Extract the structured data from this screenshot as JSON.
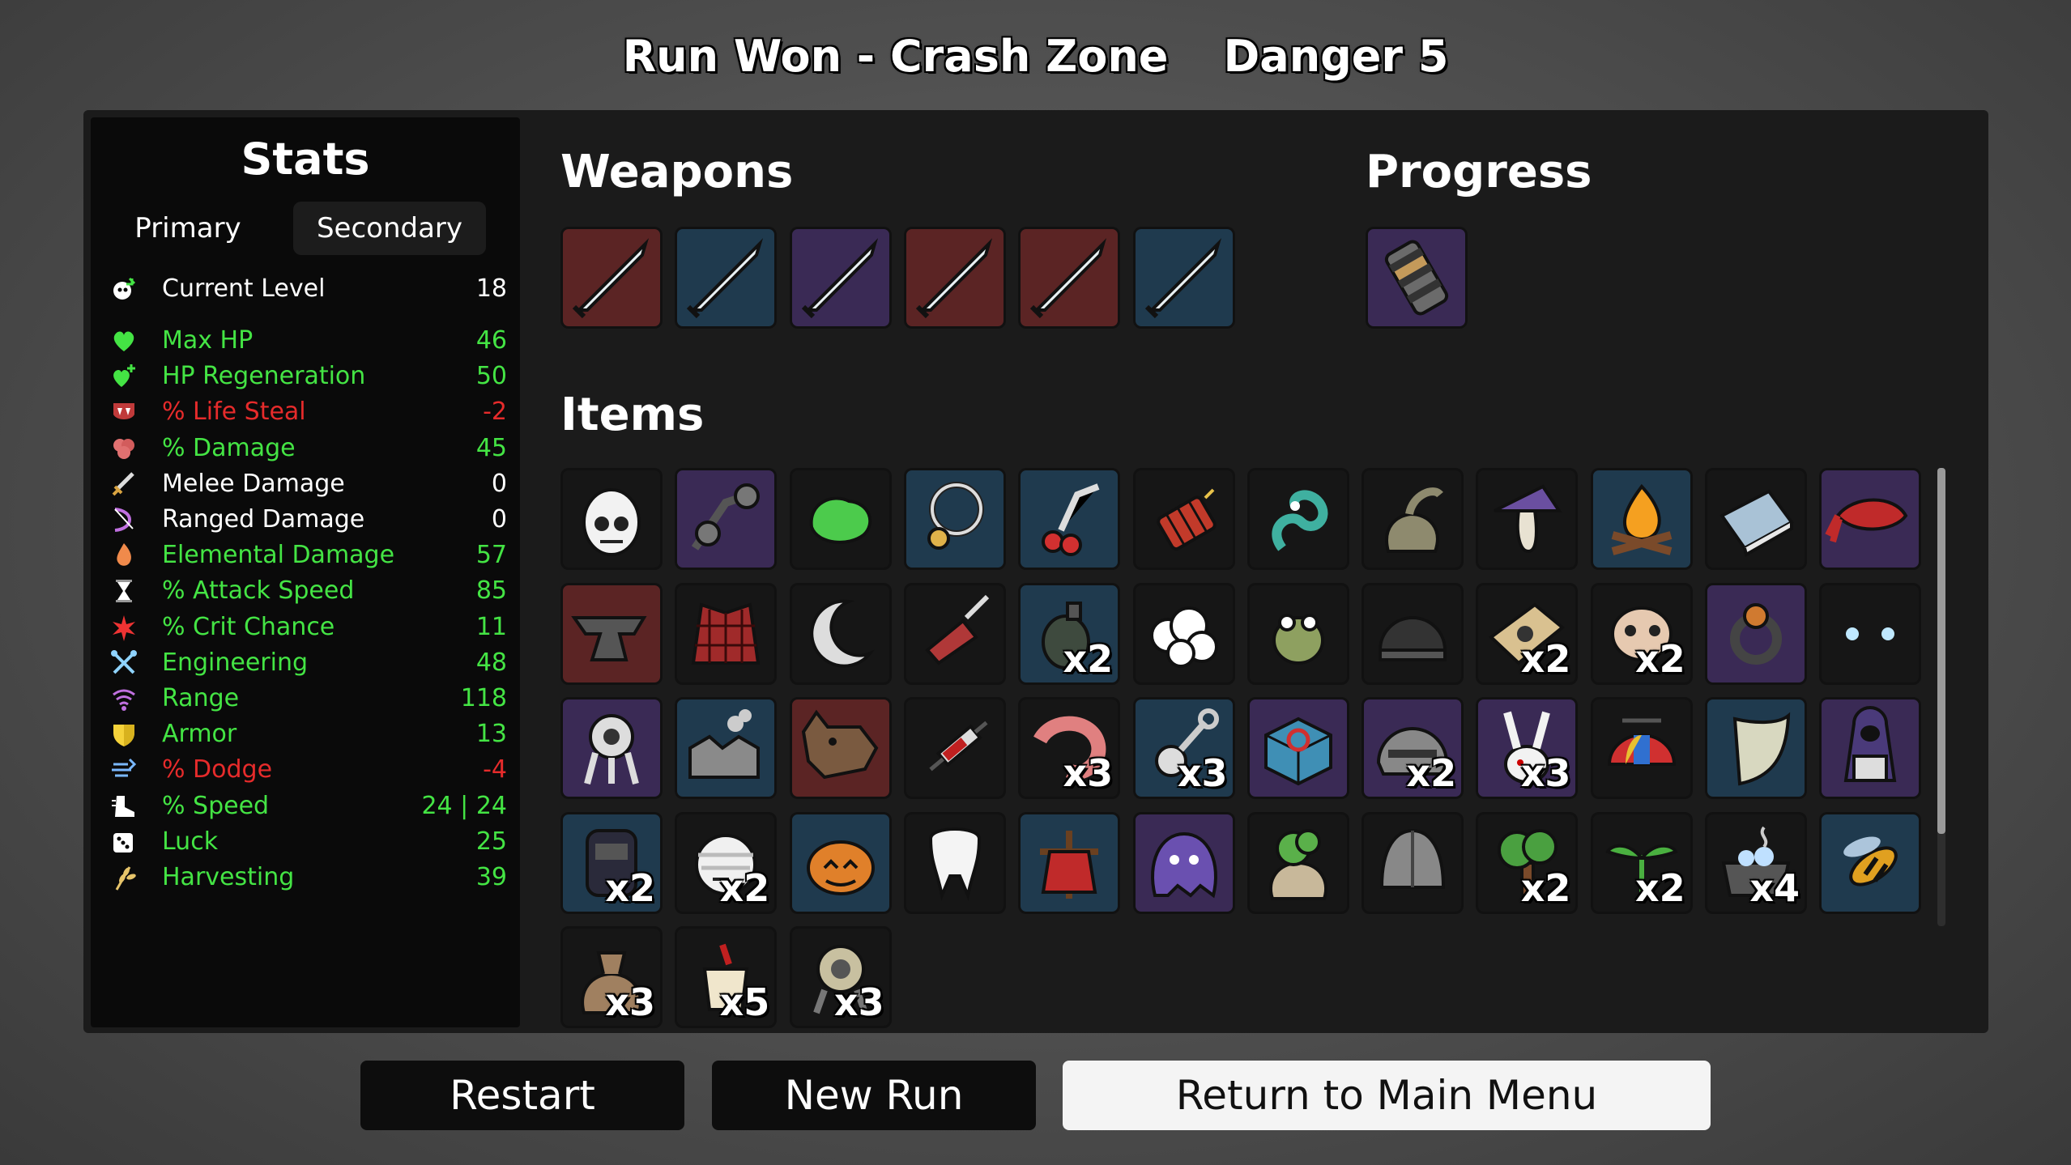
{
  "header": {
    "run_result": "Run Won - Crash Zone",
    "danger": "Danger 5"
  },
  "stats": {
    "title": "Stats",
    "tabs": [
      {
        "label": "Primary"
      },
      {
        "label": "Secondary"
      }
    ],
    "current_level": {
      "label": "Current Level",
      "value": "18",
      "icon": "level-icon"
    },
    "rows": [
      {
        "label": "Max HP",
        "value": "46",
        "color": "#44e444",
        "icon": "heart-icon"
      },
      {
        "label": "HP Regeneration",
        "value": "50",
        "color": "#44e444",
        "icon": "heart-plus-icon"
      },
      {
        "label": "% Life Steal",
        "value": "-2",
        "color": "#e62b2b",
        "icon": "fangs-icon"
      },
      {
        "label": "% Damage",
        "value": "45",
        "color": "#44e444",
        "icon": "brain-icon"
      },
      {
        "label": "Melee Damage",
        "value": "0",
        "color": "#ffffff",
        "icon": "sword-icon"
      },
      {
        "label": "Ranged Damage",
        "value": "0",
        "color": "#ffffff",
        "icon": "bow-icon"
      },
      {
        "label": "Elemental Damage",
        "value": "57",
        "color": "#44e444",
        "icon": "flame-icon"
      },
      {
        "label": "% Attack Speed",
        "value": "85",
        "color": "#44e444",
        "icon": "hourglass-icon"
      },
      {
        "label": "% Crit Chance",
        "value": "11",
        "color": "#44e444",
        "icon": "crit-star-icon"
      },
      {
        "label": "Engineering",
        "value": "48",
        "color": "#44e444",
        "icon": "wrench-cross-icon"
      },
      {
        "label": "Range",
        "value": "118",
        "color": "#44e444",
        "icon": "range-waves-icon"
      },
      {
        "label": "Armor",
        "value": "13",
        "color": "#44e444",
        "icon": "shield-icon"
      },
      {
        "label": "% Dodge",
        "value": "-4",
        "color": "#e62b2b",
        "icon": "dodge-wind-icon"
      },
      {
        "label": "% Speed",
        "value": "24 | 24",
        "color": "#44e444",
        "icon": "boot-icon"
      },
      {
        "label": "Luck",
        "value": "25",
        "color": "#44e444",
        "icon": "dice-icon"
      },
      {
        "label": "Harvesting",
        "value": "39",
        "color": "#44e444",
        "icon": "wheat-icon"
      }
    ]
  },
  "weapons": {
    "title": "Weapons",
    "slots": [
      {
        "tier": "red",
        "icon": "thief-dagger-icon"
      },
      {
        "tier": "blue",
        "icon": "thief-dagger-icon"
      },
      {
        "tier": "purple",
        "icon": "thief-dagger-icon"
      },
      {
        "tier": "red",
        "icon": "thief-dagger-icon"
      },
      {
        "tier": "red",
        "icon": "thief-dagger-icon"
      },
      {
        "tier": "blue",
        "icon": "thief-dagger-icon"
      }
    ]
  },
  "progress": {
    "title": "Progress",
    "slots": [
      {
        "tier": "purple",
        "icon": "crate-canister-icon"
      }
    ]
  },
  "items": {
    "title": "Items",
    "rows": [
      [
        {
          "tier": "dark",
          "icon": "cracked-egg-skull-icon",
          "qty": ""
        },
        {
          "tier": "purple",
          "icon": "goggles-icon",
          "qty": ""
        },
        {
          "tier": "dark",
          "icon": "green-slime-icon",
          "qty": ""
        },
        {
          "tier": "blue",
          "icon": "amulet-icon",
          "qty": ""
        },
        {
          "tier": "blue",
          "icon": "cherry-knife-icon",
          "qty": ""
        },
        {
          "tier": "dark",
          "icon": "dynamite-icon",
          "qty": ""
        },
        {
          "tier": "dark",
          "icon": "tentacle-icon",
          "qty": ""
        },
        {
          "tier": "dark",
          "icon": "sack-icon",
          "qty": ""
        },
        {
          "tier": "dark",
          "icon": "mushroom-hat-icon",
          "qty": ""
        },
        {
          "tier": "blue",
          "icon": "campfire-icon",
          "qty": ""
        },
        {
          "tier": "dark",
          "icon": "book-icon",
          "qty": ""
        },
        {
          "tier": "purple",
          "icon": "bandana-icon",
          "qty": ""
        }
      ],
      [
        {
          "tier": "red",
          "icon": "anvil-icon",
          "qty": ""
        },
        {
          "tier": "dark",
          "icon": "plaid-shirt-icon",
          "qty": ""
        },
        {
          "tier": "dark",
          "icon": "crescent-icon",
          "qty": ""
        },
        {
          "tier": "dark",
          "icon": "meat-knife-icon",
          "qty": ""
        },
        {
          "tier": "blue",
          "icon": "grenade-icon",
          "qty": "x2"
        },
        {
          "tier": "dark",
          "icon": "fluffy-cloud-icon",
          "qty": ""
        },
        {
          "tier": "dark",
          "icon": "frog-icon",
          "qty": ""
        },
        {
          "tier": "dark",
          "icon": "helmet-dome-icon",
          "qty": ""
        },
        {
          "tier": "dark",
          "icon": "treasure-map-icon",
          "qty": "x2"
        },
        {
          "tier": "dark",
          "icon": "pig-skull-icon",
          "qty": "x2"
        },
        {
          "tier": "purple",
          "icon": "ring-icon",
          "qty": ""
        },
        {
          "tier": "dark",
          "icon": "glowing-eyes-icon",
          "qty": ""
        }
      ],
      [
        {
          "tier": "purple",
          "icon": "robot-walker-icon",
          "qty": ""
        },
        {
          "tier": "blue",
          "icon": "factory-icon",
          "qty": ""
        },
        {
          "tier": "red",
          "icon": "wolf-head-icon",
          "qty": ""
        },
        {
          "tier": "dark",
          "icon": "syringe-icon",
          "qty": ""
        },
        {
          "tier": "dark",
          "icon": "shrimp-icon",
          "qty": "x3"
        },
        {
          "tier": "blue",
          "icon": "wrench-bot-icon",
          "qty": "x3"
        },
        {
          "tier": "purple",
          "icon": "blue-crate-icon",
          "qty": ""
        },
        {
          "tier": "purple",
          "icon": "metal-helmet-icon",
          "qty": "x2"
        },
        {
          "tier": "purple",
          "icon": "bunny-icon",
          "qty": "x3"
        },
        {
          "tier": "dark",
          "icon": "propeller-cap-icon",
          "qty": ""
        },
        {
          "tier": "blue",
          "icon": "bracer-icon",
          "qty": ""
        },
        {
          "tier": "purple",
          "icon": "hooded-figure-icon",
          "qty": ""
        }
      ],
      [
        {
          "tier": "blue",
          "icon": "backpack-icon",
          "qty": "x2"
        },
        {
          "tier": "dark",
          "icon": "bandaged-head-icon",
          "qty": "x2"
        },
        {
          "tier": "blue",
          "icon": "pumpkin-icon",
          "qty": ""
        },
        {
          "tier": "dark",
          "icon": "tooth-icon",
          "qty": ""
        },
        {
          "tier": "blue",
          "icon": "scarecrow-icon",
          "qty": ""
        },
        {
          "tier": "purple",
          "icon": "ghost-blob-icon",
          "qty": ""
        },
        {
          "tier": "dark",
          "icon": "herb-bag-icon",
          "qty": ""
        },
        {
          "tier": "dark",
          "icon": "knight-helmet-icon",
          "qty": ""
        },
        {
          "tier": "dark",
          "icon": "tree-icon",
          "qty": "x2"
        },
        {
          "tier": "dark",
          "icon": "sprout-icon",
          "qty": "x2"
        },
        {
          "tier": "dark",
          "icon": "cooking-pot-icon",
          "qty": "x4"
        },
        {
          "tier": "blue",
          "icon": "hornet-icon",
          "qty": ""
        }
      ],
      [
        {
          "tier": "dark",
          "icon": "coin-sack-icon",
          "qty": "x3"
        },
        {
          "tier": "dark",
          "icon": "cup-icon",
          "qty": "x5"
        },
        {
          "tier": "dark",
          "icon": "turret-icon",
          "qty": "x3"
        }
      ]
    ]
  },
  "buttons": {
    "restart": "Restart",
    "new_run": "New Run",
    "main_menu": "Return to Main Menu"
  }
}
